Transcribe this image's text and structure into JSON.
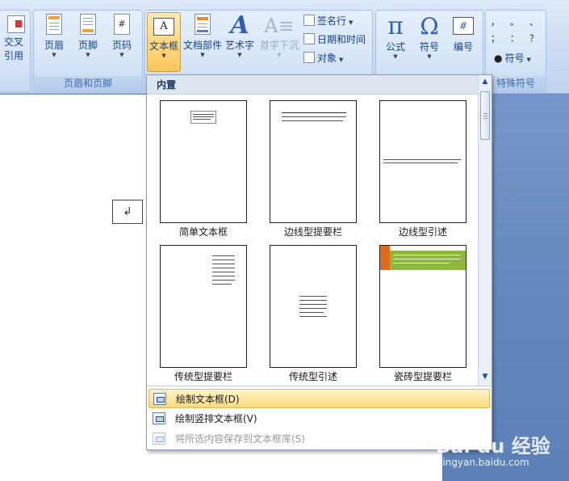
{
  "ribbon": {
    "crossref": {
      "label_line1": "交叉",
      "label_line2": "引用"
    },
    "header_footer_group": {
      "label": "页眉和页脚",
      "buttons": [
        {
          "label": "页眉"
        },
        {
          "label": "页脚"
        },
        {
          "label": "页码"
        }
      ]
    },
    "text_group": {
      "buttons": [
        {
          "label": "文本框",
          "state": "pressed"
        },
        {
          "label": "文档部件"
        },
        {
          "label": "艺术字"
        },
        {
          "label": "首字下沉",
          "state": "disabled"
        }
      ],
      "small_buttons": [
        {
          "label": "签名行",
          "icon": "signature-line-icon"
        },
        {
          "label": "日期和时间",
          "icon": "date-time-icon"
        },
        {
          "label": "对象",
          "icon": "object-icon"
        }
      ]
    },
    "symbols_group": {
      "buttons": [
        {
          "label": "公式",
          "glyph": "π"
        },
        {
          "label": "符号",
          "glyph": "Ω"
        },
        {
          "label": "编号",
          "glyph": "#"
        }
      ]
    },
    "special_symbols_group": {
      "label": "特殊符号",
      "glyphs": [
        "，",
        "。",
        "、",
        "；",
        "：",
        "？"
      ],
      "symbol_button": {
        "label": "符号"
      }
    }
  },
  "document": {
    "paragraph_mark": "↲"
  },
  "gallery": {
    "header": "内置",
    "items": [
      {
        "label": "简单文本框"
      },
      {
        "label": "边线型提要栏"
      },
      {
        "label": "边线型引述"
      },
      {
        "label": "传统型提要栏"
      },
      {
        "label": "传统型引述"
      },
      {
        "label": "瓷砖型提要栏"
      }
    ],
    "menu": [
      {
        "label": "绘制文本框(D)",
        "state": "highlighted"
      },
      {
        "label": "绘制竖排文本框(V)",
        "state": "normal"
      },
      {
        "label": "将所选内容保存到文本框库(S)",
        "state": "disabled"
      }
    ],
    "accent_colors": {
      "orange": "#e06b1b",
      "green": "#8db83a"
    }
  },
  "watermark": {
    "logo": "Bai du 经验",
    "url": "jingyan.baidu.com"
  }
}
